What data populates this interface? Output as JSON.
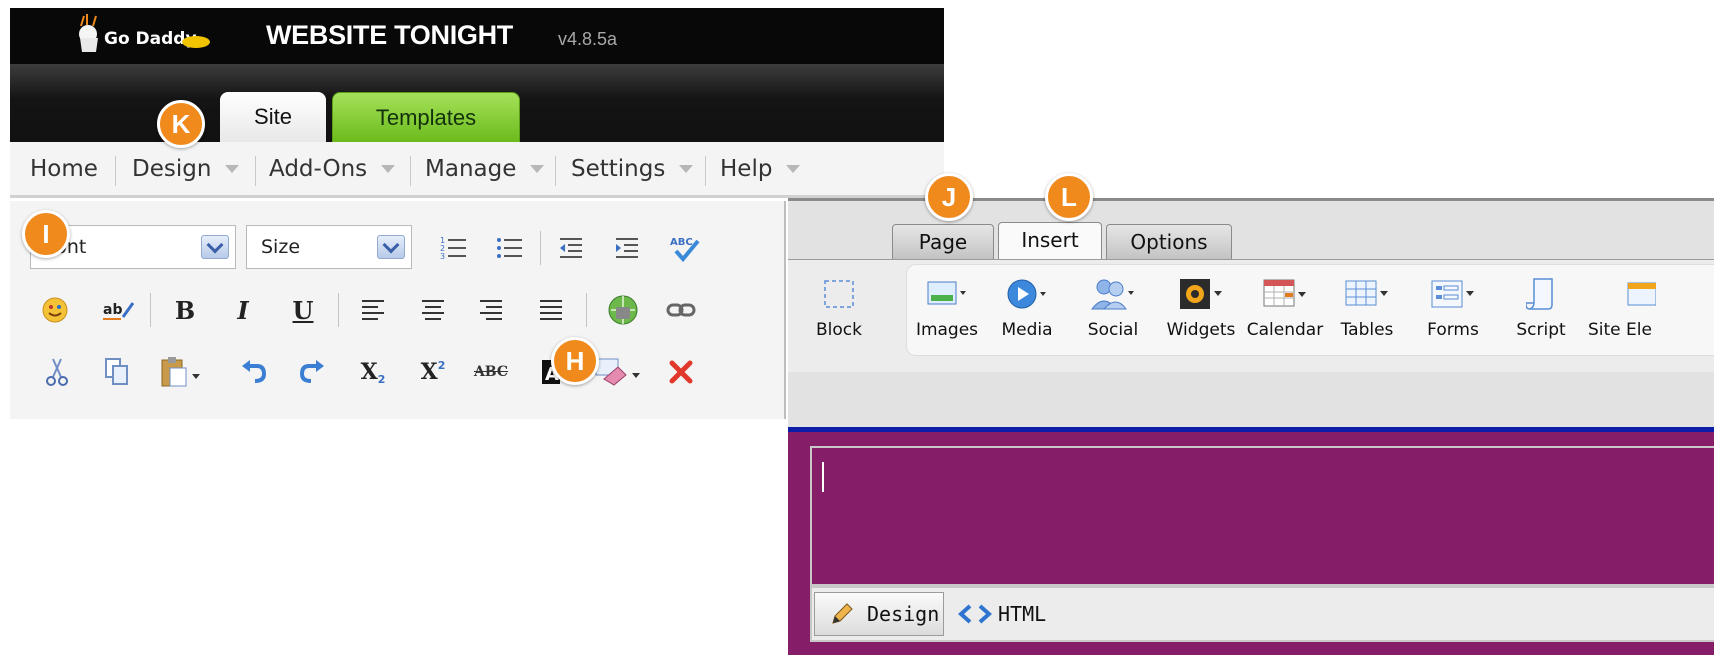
{
  "app": {
    "logo_text": "Go Daddy",
    "title": "WEBSITE TONIGHT",
    "version": "v4.8.5a"
  },
  "header_tabs": [
    {
      "label": "Site",
      "active": true
    },
    {
      "label": "Templates",
      "active": false
    }
  ],
  "menu": [
    {
      "label": "Home",
      "has_dropdown": false
    },
    {
      "label": "Design",
      "has_dropdown": true
    },
    {
      "label": "Add-Ons",
      "has_dropdown": true
    },
    {
      "label": "Manage",
      "has_dropdown": true
    },
    {
      "label": "Settings",
      "has_dropdown": true
    },
    {
      "label": "Help",
      "has_dropdown": true
    }
  ],
  "toolbar": {
    "font_value": "Font",
    "size_value": "Size",
    "bold": "B",
    "italic": "I",
    "underline": "U",
    "subscript": "X",
    "superscript": "X",
    "strike": "ABC"
  },
  "badges": {
    "h": "H",
    "i": "I",
    "j": "J",
    "k": "K",
    "l": "L"
  },
  "editor_tabs": [
    {
      "label": "Page",
      "active": false
    },
    {
      "label": "Insert",
      "active": true
    },
    {
      "label": "Options",
      "active": false
    }
  ],
  "ribbon": [
    {
      "label": "Block",
      "icon": "block-icon"
    },
    {
      "label": "Images",
      "icon": "images-icon"
    },
    {
      "label": "Media",
      "icon": "media-icon"
    },
    {
      "label": "Social",
      "icon": "social-icon"
    },
    {
      "label": "Widgets",
      "icon": "widgets-icon"
    },
    {
      "label": "Calendar",
      "icon": "calendar-icon"
    },
    {
      "label": "Tables",
      "icon": "tables-icon"
    },
    {
      "label": "Forms",
      "icon": "forms-icon"
    },
    {
      "label": "Script",
      "icon": "script-icon"
    },
    {
      "label": "Site Ele",
      "icon": "site-elements-icon"
    }
  ],
  "mode_bar": {
    "design_label": "Design",
    "html_label": "HTML"
  },
  "colors": {
    "canvas": "#861d69",
    "templates_tab": "#7cc62a",
    "badge": "#f08a1c",
    "header": "#080808"
  }
}
